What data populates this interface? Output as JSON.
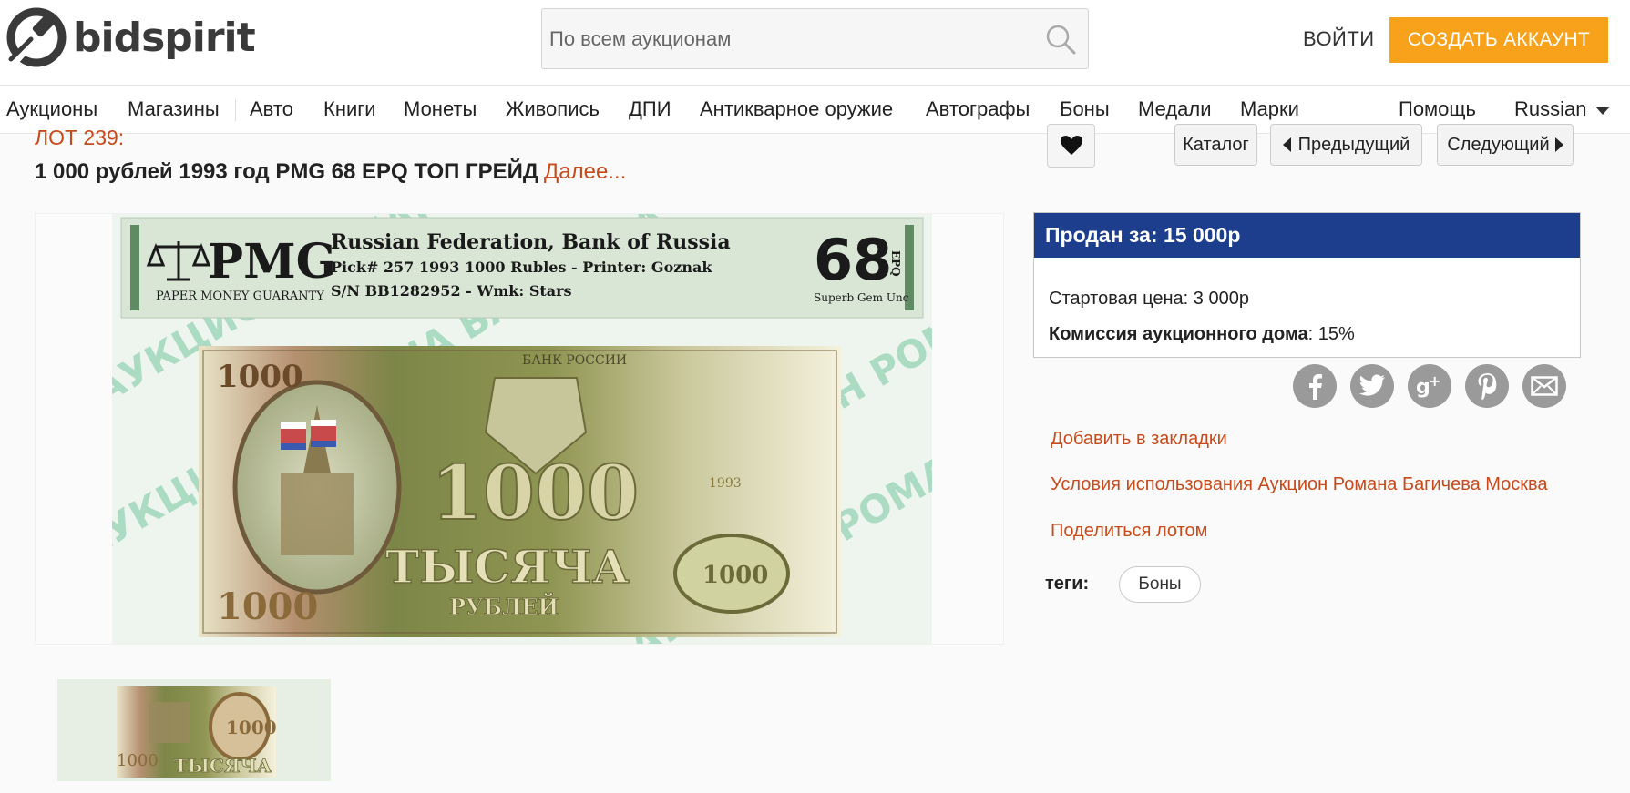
{
  "header": {
    "logo_text": "bidspirit",
    "search_placeholder": "По всем аукционам",
    "login": "ВОЙТИ",
    "create_account": "СОЗДАТЬ АККАУНТ"
  },
  "nav": {
    "items": [
      "Аукционы",
      "Магазины",
      "Авто",
      "Книги",
      "Монеты",
      "Живопись",
      "ДПИ",
      "Антикварное оружие",
      "Автографы",
      "Боны",
      "Медали",
      "Марки"
    ],
    "help": "Помощь",
    "language": "Russian"
  },
  "lot": {
    "number": "ЛОТ 239:",
    "title": "1 000 рублей 1993 год PMG 68 EPQ ТОП ГРЕЙД",
    "more": "Далее..."
  },
  "toolbar": {
    "catalog": "Каталог",
    "previous": "Предыдущий",
    "next": "Следующий"
  },
  "banknote": {
    "pmg_logo": "PMG",
    "pmg_subtitle": "PAPER MONEY GUARANTY",
    "label_line1": "Russian Federation, Bank of Russia",
    "label_line2": "Pick# 257  1993  1000 Rubles - Printer: Goznak",
    "label_line3": "S/N BB1282952 - Wmk: Stars",
    "grade": "68",
    "grade_suffix": "EPQ",
    "grade_desc": "Superb Gem Unc",
    "note_value": "1000",
    "note_words": "ТЫСЯЧА",
    "note_currency": "РУБЛЕЙ",
    "note_bank": "БАНК РОССИИ",
    "note_year": "1993",
    "watermark": "АУКЦИОН РОМАНА БАГИЧЕВА"
  },
  "price": {
    "sold_label": "Продан за:",
    "sold_value": "15 000р",
    "start_label": "Стартовая цена:",
    "start_value": "3 000р",
    "commission_label": "Комиссия аукционного дома",
    "commission_value": ": 15%"
  },
  "social": [
    "facebook-icon",
    "twitter-icon",
    "google-plus-icon",
    "pinterest-icon",
    "mail-icon"
  ],
  "links": {
    "bookmark": "Добавить в закладки",
    "terms": "Условия использования Аукцион Романа Багичева Москва",
    "share": "Поделиться лотом"
  },
  "tags": {
    "label": "теги:",
    "items": [
      "Боны"
    ]
  },
  "colors": {
    "accent_orange": "#f7a21a",
    "link_red": "#c84a1a",
    "price_blue": "#1c3e8c"
  }
}
